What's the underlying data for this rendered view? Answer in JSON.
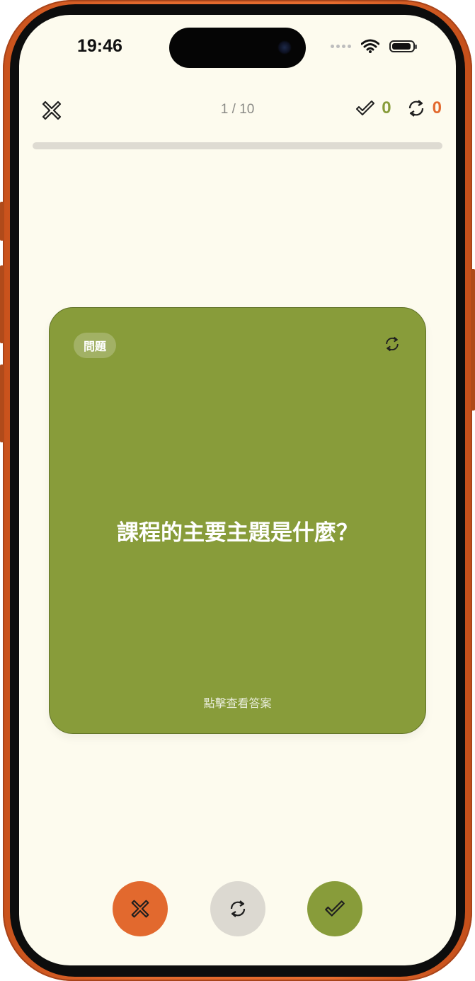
{
  "status_bar": {
    "time": "19:46"
  },
  "header": {
    "progress_text": "1 / 10",
    "correct_count": "0",
    "repeat_count": "0",
    "progress_fraction": 0.0
  },
  "card": {
    "badge": "問題",
    "question": "課程的主要主題是什麼？",
    "hint": "點擊查看答案"
  },
  "colors": {
    "green": "#889c3a",
    "orange": "#e2692e",
    "background": "#fdfbee",
    "track": "#dedbd2"
  },
  "icons": {
    "close": "close-icon",
    "correct": "check-icon",
    "repeat": "refresh-icon",
    "flip": "flip-icon",
    "wrong": "x-icon"
  }
}
